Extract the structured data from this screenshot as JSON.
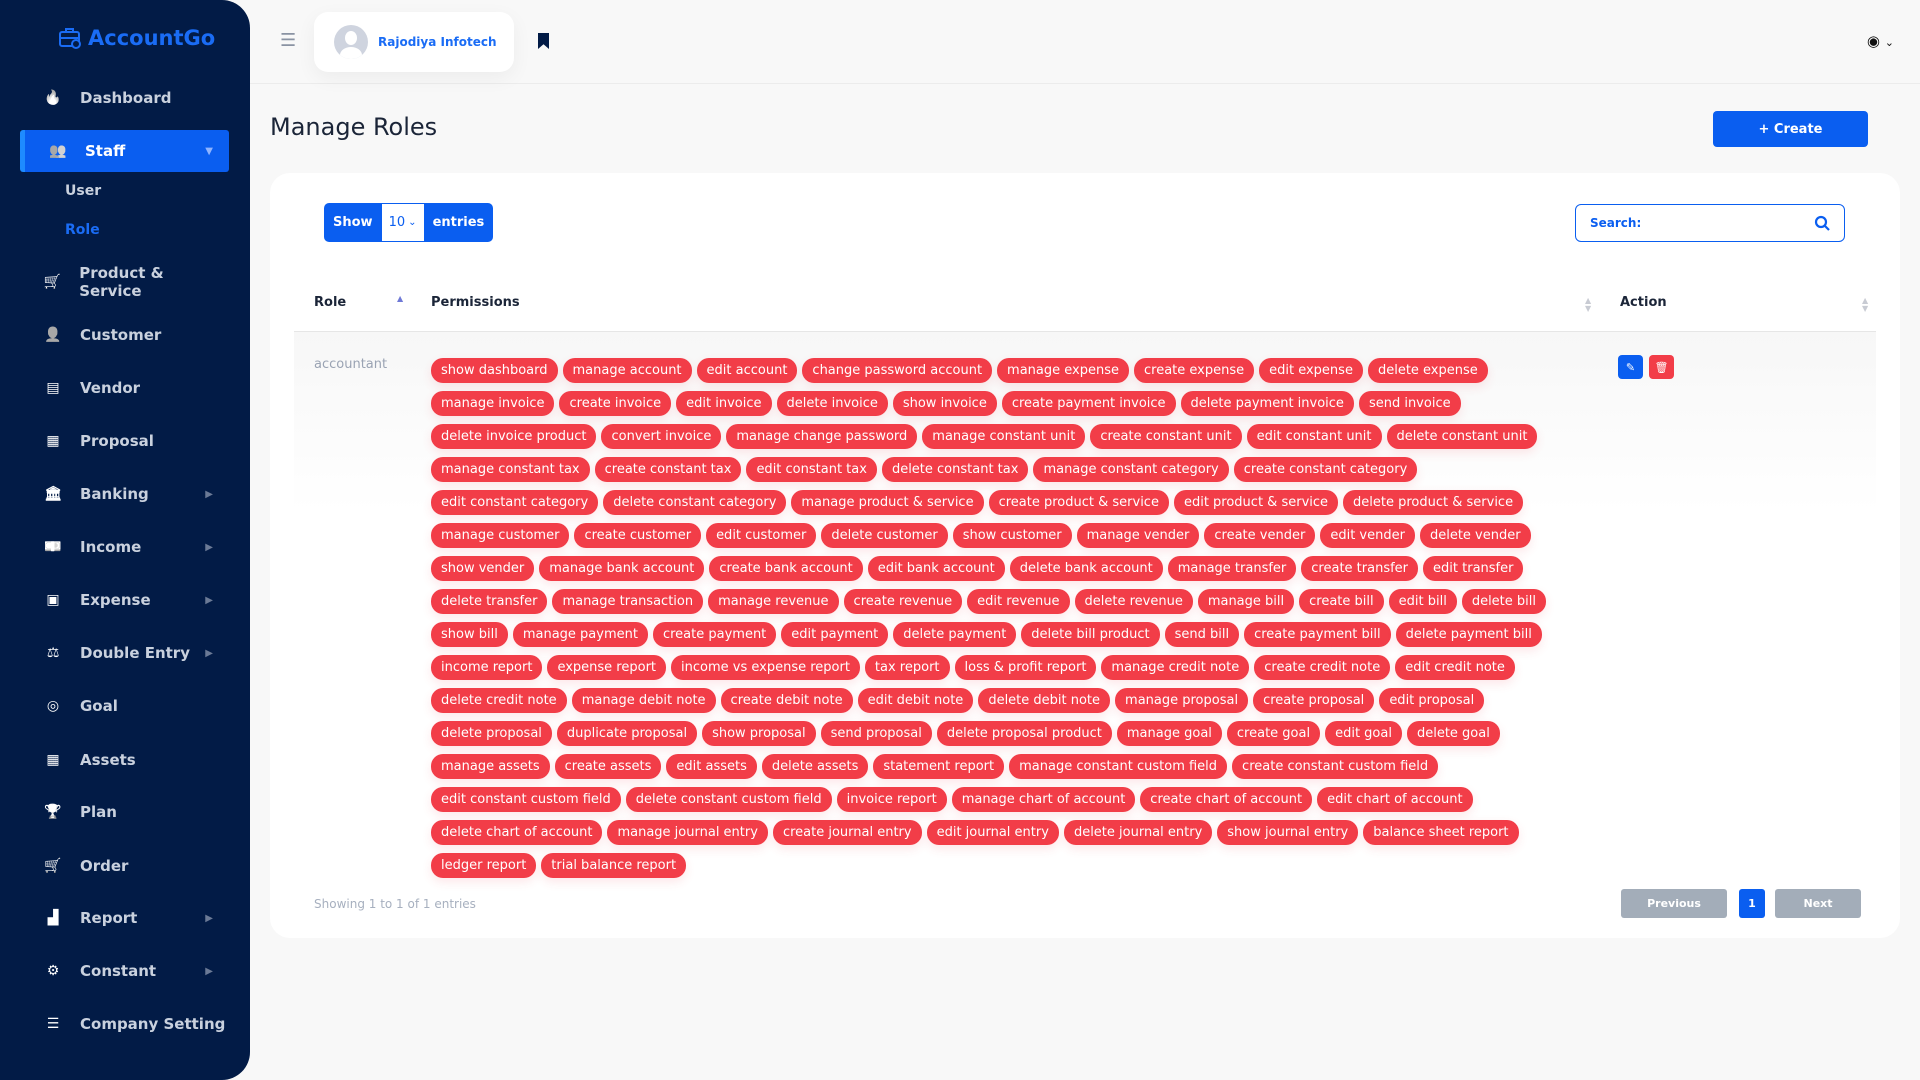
{
  "app": {
    "name": "AccountGo"
  },
  "sidebar": {
    "items": [
      {
        "label": "Dashboard",
        "icon": "fire-icon"
      },
      {
        "label": "Staff",
        "icon": "users-icon",
        "active": true,
        "expanded": true,
        "children": [
          {
            "label": "User"
          },
          {
            "label": "Role",
            "active": true
          }
        ]
      },
      {
        "label": "Product & Service",
        "icon": "cart-icon"
      },
      {
        "label": "Customer",
        "icon": "user-icon"
      },
      {
        "label": "Vendor",
        "icon": "note-icon"
      },
      {
        "label": "Proposal",
        "icon": "file-icon"
      },
      {
        "label": "Banking",
        "icon": "bank-icon",
        "has_children": true
      },
      {
        "label": "Income",
        "icon": "money-icon",
        "has_children": true
      },
      {
        "label": "Expense",
        "icon": "wallet-icon",
        "has_children": true
      },
      {
        "label": "Double Entry",
        "icon": "balance-icon",
        "has_children": true
      },
      {
        "label": "Goal",
        "icon": "target-icon"
      },
      {
        "label": "Assets",
        "icon": "calculator-icon"
      },
      {
        "label": "Plan",
        "icon": "trophy-icon"
      },
      {
        "label": "Order",
        "icon": "cart-icon"
      },
      {
        "label": "Report",
        "icon": "chart-icon",
        "has_children": true
      },
      {
        "label": "Constant",
        "icon": "gear-icon",
        "has_children": true
      },
      {
        "label": "Company Setting",
        "icon": "sliders-icon"
      }
    ]
  },
  "header": {
    "user_name": "Rajodiya Infotech",
    "lang_icon": "globe-icon"
  },
  "page": {
    "title": "Manage Roles",
    "create_label": "+ Create"
  },
  "table": {
    "show_label": "Show",
    "entries_label": "entries",
    "page_size": "10",
    "search_label": "Search:",
    "columns": [
      "Role",
      "Permissions",
      "Action"
    ],
    "rows": [
      {
        "role": "accountant",
        "permissions": [
          "show dashboard",
          "manage account",
          "edit account",
          "change password account",
          "manage expense",
          "create expense",
          "edit expense",
          "delete expense",
          "manage invoice",
          "create invoice",
          "edit invoice",
          "delete invoice",
          "show invoice",
          "create payment invoice",
          "delete payment invoice",
          "send invoice",
          "delete invoice product",
          "convert invoice",
          "manage change password",
          "manage constant unit",
          "create constant unit",
          "edit constant unit",
          "delete constant unit",
          "manage constant tax",
          "create constant tax",
          "edit constant tax",
          "delete constant tax",
          "manage constant category",
          "create constant category",
          "edit constant category",
          "delete constant category",
          "manage product & service",
          "create product & service",
          "edit product & service",
          "delete product & service",
          "manage customer",
          "create customer",
          "edit customer",
          "delete customer",
          "show customer",
          "manage vender",
          "create vender",
          "edit vender",
          "delete vender",
          "show vender",
          "manage bank account",
          "create bank account",
          "edit bank account",
          "delete bank account",
          "manage transfer",
          "create transfer",
          "edit transfer",
          "delete transfer",
          "manage transaction",
          "manage revenue",
          "create revenue",
          "edit revenue",
          "delete revenue",
          "manage bill",
          "create bill",
          "edit bill",
          "delete bill",
          "show bill",
          "manage payment",
          "create payment",
          "edit payment",
          "delete payment",
          "delete bill product",
          "send bill",
          "create payment bill",
          "delete payment bill",
          "income report",
          "expense report",
          "income vs expense report",
          "tax report",
          "loss & profit report",
          "manage credit note",
          "create credit note",
          "edit credit note",
          "delete credit note",
          "manage debit note",
          "create debit note",
          "edit debit note",
          "delete debit note",
          "manage proposal",
          "create proposal",
          "edit proposal",
          "delete proposal",
          "duplicate proposal",
          "show proposal",
          "send proposal",
          "delete proposal product",
          "manage goal",
          "create goal",
          "edit goal",
          "delete goal",
          "manage assets",
          "create assets",
          "edit assets",
          "delete assets",
          "statement report",
          "manage constant custom field",
          "create constant custom field",
          "edit constant custom field",
          "delete constant custom field",
          "invoice report",
          "manage chart of account",
          "create chart of account",
          "edit chart of account",
          "delete chart of account",
          "manage journal entry",
          "create journal entry",
          "edit journal entry",
          "delete journal entry",
          "show journal entry",
          "balance sheet report",
          "ledger report",
          "trial balance report"
        ]
      }
    ],
    "info": "Showing 1 to 1 of 1 entries",
    "pagination": {
      "previous": "Previous",
      "current": "1",
      "next": "Next"
    }
  },
  "colors": {
    "sidebar": "#021b46",
    "accent": "#0a5ef0",
    "tag": "#f23d48",
    "delete": "#f23d48"
  }
}
